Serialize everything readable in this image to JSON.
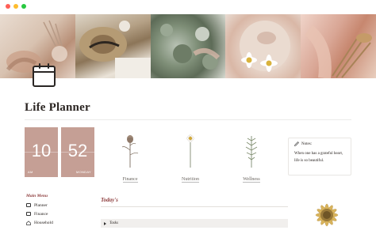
{
  "window": {
    "dots": [
      {
        "name": "close",
        "color": "#ff5f57"
      },
      {
        "name": "minimize",
        "color": "#febc2e"
      },
      {
        "name": "maximize",
        "color": "#28c840"
      }
    ]
  },
  "banner": {
    "panels": [
      "dried-flowers-hand",
      "straw-hat-linen",
      "greenery-bouquet",
      "daisy-bowl",
      "dried-flower-bundle"
    ]
  },
  "page": {
    "icon": "calendar-icon",
    "title": "Life Planner"
  },
  "clock": {
    "hour": "10",
    "hour_label": "AM",
    "minute": "52",
    "minute_label": "MONDAY",
    "color": "#c59f95"
  },
  "gallery": [
    {
      "label": "Finance",
      "icon": "dried-rose-icon"
    },
    {
      "label": "Nutrition",
      "icon": "daisy-icon"
    },
    {
      "label": "Wellness",
      "icon": "fern-icon"
    }
  ],
  "notes": {
    "title": "Notes:",
    "text": "When one has a grateful heart, life is so beautiful."
  },
  "menu": {
    "title": "Main Menu",
    "items": [
      {
        "label": "Planner",
        "icon": "calendar-icon"
      },
      {
        "label": "Finance",
        "icon": "money-icon"
      },
      {
        "label": "Household",
        "icon": "home-icon"
      }
    ]
  },
  "today": {
    "heading": "Today's",
    "toggle_label": "Tasks"
  },
  "accent": "#8c3b3b"
}
